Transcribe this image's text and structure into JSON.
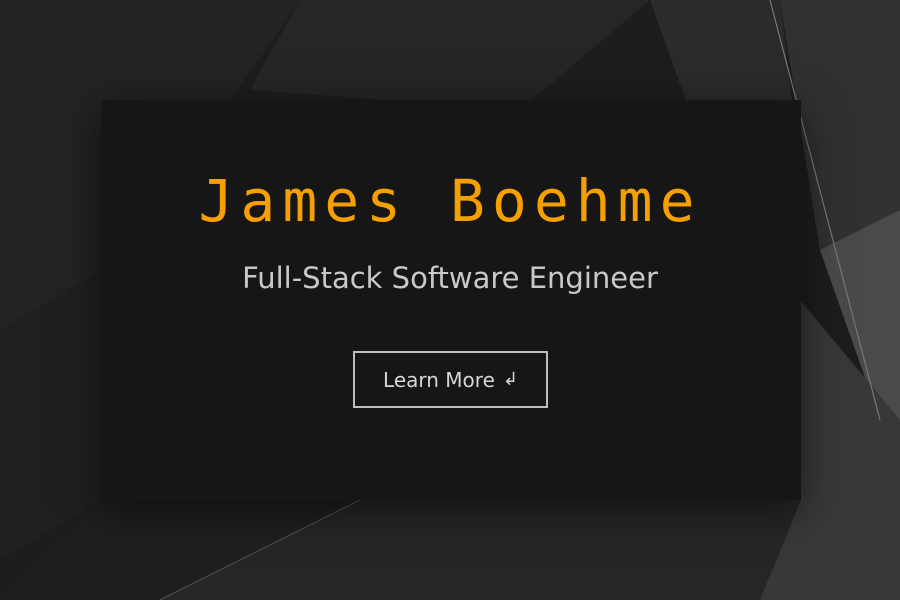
{
  "hero": {
    "name": "James Boehme",
    "title": "Full-Stack Software Engineer",
    "cta_label": "Learn More",
    "cta_icon": "↲"
  },
  "colors": {
    "accent": "#f5a000",
    "background": "#1c1c1c",
    "card": "#161616",
    "text": "#c9c9c9",
    "button_border": "#bdbdbd"
  },
  "icons": {
    "cta_icon_name": "return-arrow-icon"
  }
}
